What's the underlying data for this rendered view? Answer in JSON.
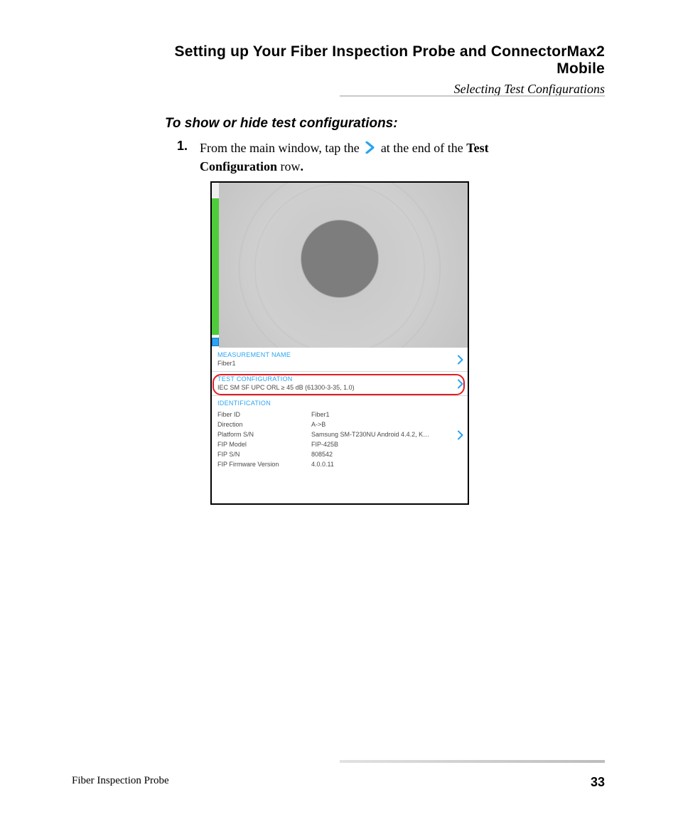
{
  "header": {
    "chapter_title": "Setting up Your Fiber Inspection Probe and ConnectorMax2 Mobile",
    "section_title": "Selecting Test Configurations"
  },
  "body": {
    "subheading": "To show or hide test configurations:",
    "step_number": "1.",
    "step_pre": "From the main window, tap the ",
    "step_post_a": " at the end of the ",
    "step_bold1": "Test Configuration",
    "step_post_b": " row",
    "step_bold2": "."
  },
  "screenshot": {
    "sections": {
      "measurement": {
        "title": "MEASUREMENT NAME",
        "value": "Fiber1"
      },
      "test_config": {
        "title": "TEST CONFIGURATION",
        "value": "IEC SM SF UPC ORL ≥ 45 dB (61300-3-35, 1.0)"
      },
      "identification": {
        "title": "IDENTIFICATION",
        "rows": [
          {
            "key": "Fiber ID",
            "value": "Fiber1"
          },
          {
            "key": "Direction",
            "value": "A->B"
          },
          {
            "key": "Platform S/N",
            "value": "Samsung SM-T230NU Android 4.4.2, K…"
          },
          {
            "key": "FIP Model",
            "value": "FIP-425B"
          },
          {
            "key": "FIP S/N",
            "value": "808542"
          },
          {
            "key": "FIP Firmware Version",
            "value": "4.0.0.11"
          }
        ]
      }
    }
  },
  "footer": {
    "doc_title": "Fiber Inspection Probe",
    "page_number": "33"
  }
}
